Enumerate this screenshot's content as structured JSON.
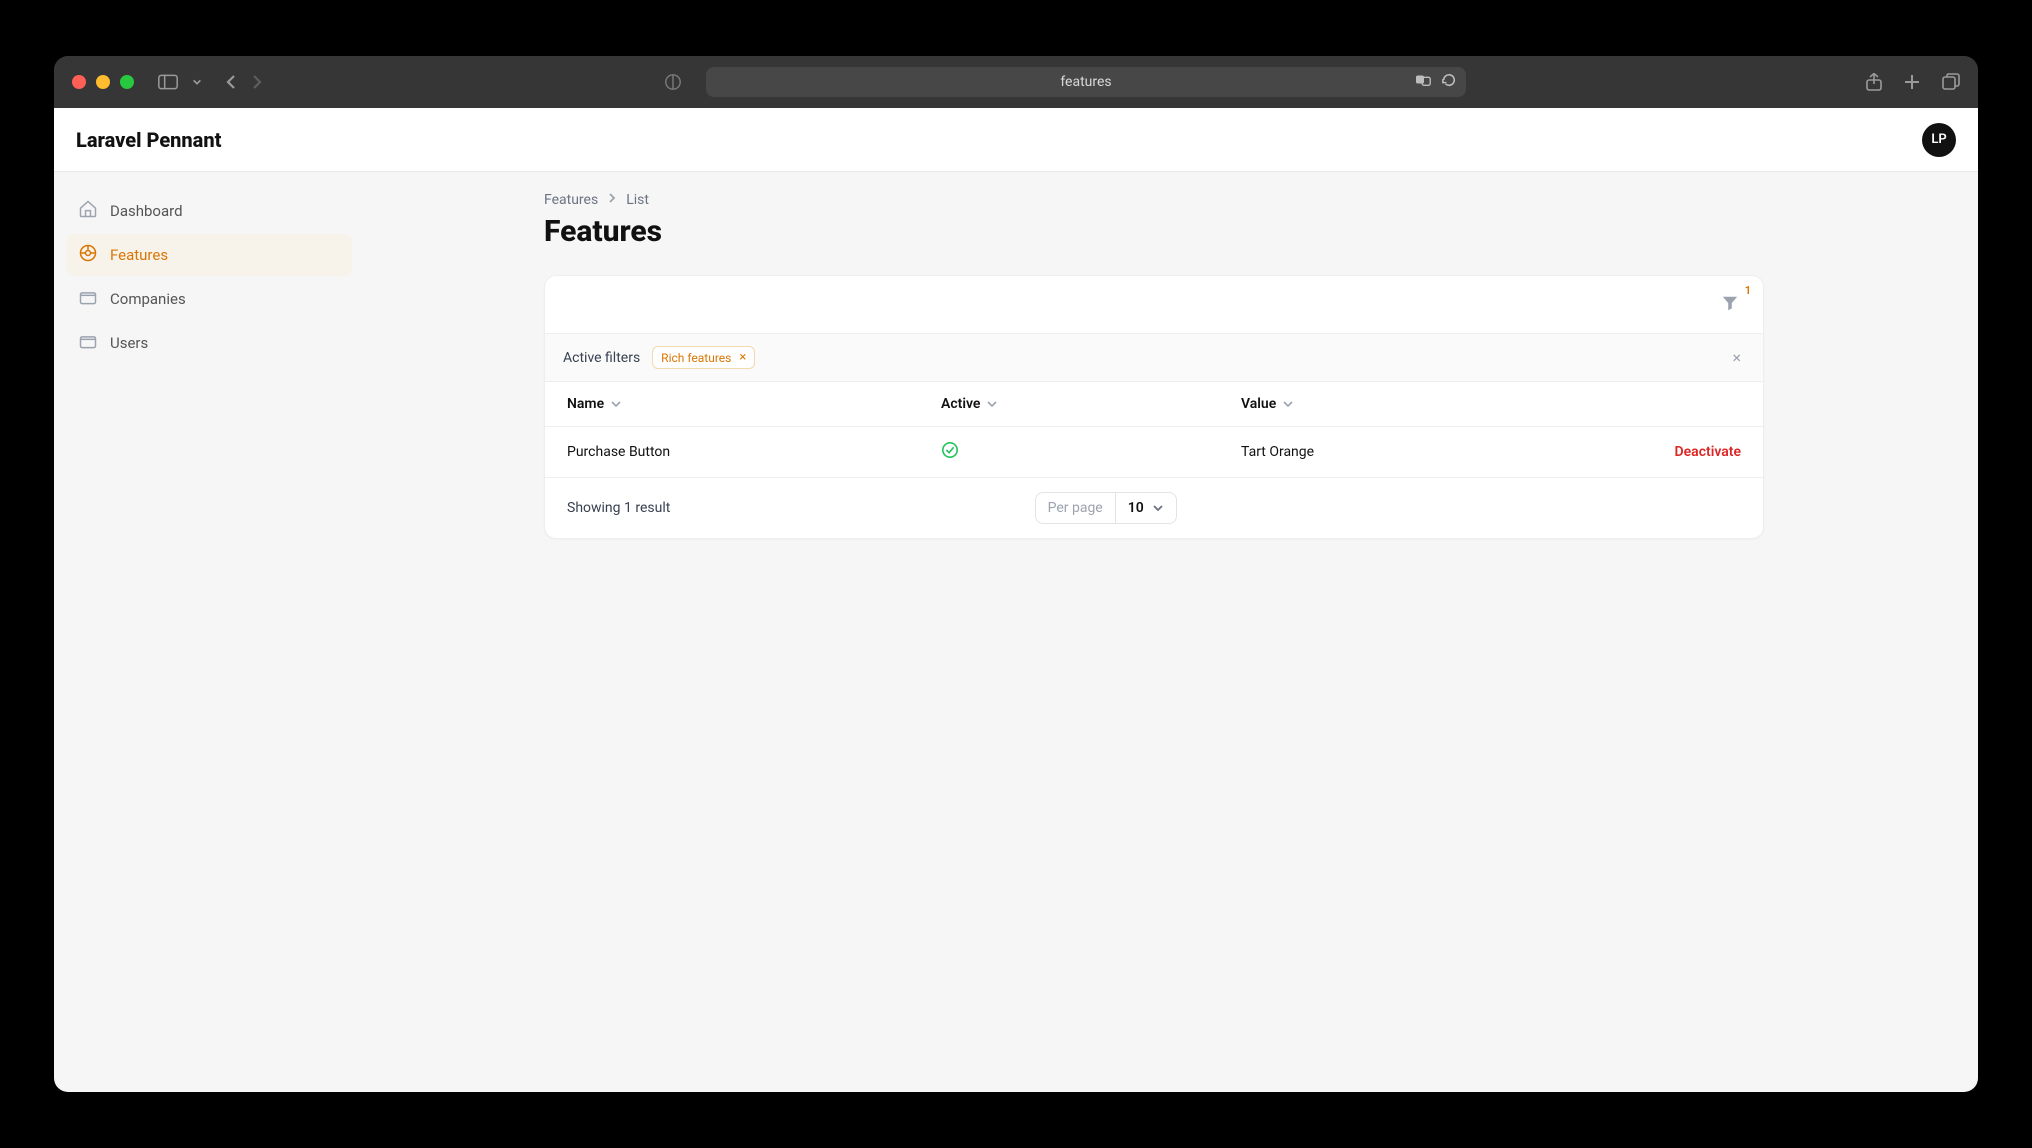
{
  "chrome": {
    "url_display": "features"
  },
  "header": {
    "brand": "Laravel Pennant",
    "avatar_initials": "LP"
  },
  "sidebar": {
    "items": [
      {
        "label": "Dashboard"
      },
      {
        "label": "Features"
      },
      {
        "label": "Companies"
      },
      {
        "label": "Users"
      }
    ]
  },
  "breadcrumb": {
    "root": "Features",
    "leaf": "List"
  },
  "page": {
    "title": "Features"
  },
  "filters": {
    "badge": "1",
    "label": "Active filters",
    "chips": [
      {
        "label": "Rich features"
      }
    ]
  },
  "table": {
    "columns": {
      "name": "Name",
      "active": "Active",
      "value": "Value"
    },
    "rows": [
      {
        "name": "Purchase Button",
        "active": true,
        "value": "Tart Orange",
        "action": "Deactivate"
      }
    ]
  },
  "footer": {
    "status": "Showing 1 result",
    "per_page_label": "Per page",
    "per_page_value": "10"
  }
}
